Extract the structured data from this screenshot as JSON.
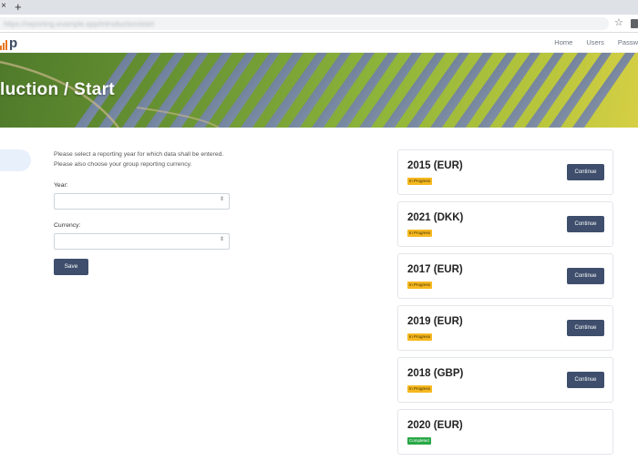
{
  "browser": {
    "tab_close": "×",
    "new_tab": "+",
    "url": "https://reporting.example.app/introduction/start",
    "star_icon": "☆"
  },
  "header": {
    "logo_text": "p",
    "nav": [
      "Home",
      "Users",
      "Passw"
    ]
  },
  "hero": {
    "title": "luction / Start"
  },
  "form": {
    "intro_line1": "Please select a reporting year for which data shall be entered.",
    "intro_line2": "Please also choose your group reporting currency.",
    "year_label": "Year:",
    "currency_label": "Currency:",
    "caret": "⇕",
    "save_label": "Save"
  },
  "cards": [
    {
      "title": "2015 (EUR)",
      "status": "In Progress",
      "action": "Continue"
    },
    {
      "title": "2021 (DKK)",
      "status": "In Progress",
      "action": "Continue"
    },
    {
      "title": "2017 (EUR)",
      "status": "In Progress",
      "action": "Continue"
    },
    {
      "title": "2019 (EUR)",
      "status": "In Progress",
      "action": "Continue"
    },
    {
      "title": "2018 (GBP)",
      "status": "In Progress",
      "action": "Continue"
    },
    {
      "title": "2020 (EUR)",
      "status": "Completed",
      "action": ""
    }
  ],
  "colors": {
    "primary_button": "#3e4e6c",
    "in_progress_badge": "#f6b820",
    "completed_badge": "#28a745",
    "logo_accent": "#e8761e"
  }
}
